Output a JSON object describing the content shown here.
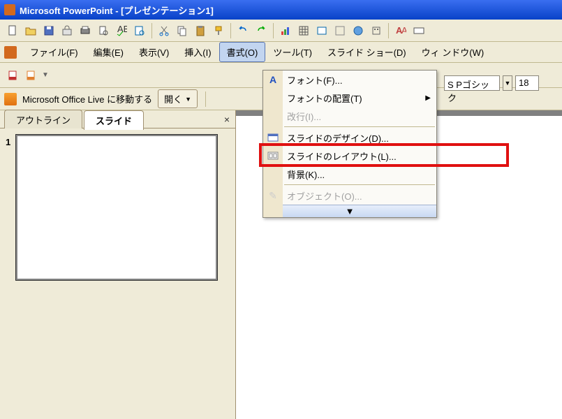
{
  "title": "Microsoft PowerPoint - [プレゼンテーション1]",
  "menubar": {
    "file": "ファイル(F)",
    "edit": "編集(E)",
    "view": "表示(V)",
    "insert": "挿入(I)",
    "format": "書式(O)",
    "tools": "ツール(T)",
    "slideshow": "スライド ショー(D)",
    "window": "ウィ ンドウ(W)"
  },
  "officelive": {
    "label": "Microsoft Office Live に移動する",
    "open": "開く"
  },
  "tabs": {
    "outline": "アウトライン",
    "slide": "スライド"
  },
  "slide_number": "1",
  "dropdown": {
    "font": "フォント(F)...",
    "font_align": "フォントの配置(T)",
    "line_break": "改行(I)...",
    "slide_design": "スライドのデザイン(D)...",
    "slide_layout": "スライドのレイアウト(L)...",
    "background": "背景(K)...",
    "object": "オブジェクト(O)...",
    "expand": "▼"
  },
  "font": {
    "name": "S Pゴシック",
    "size": "18"
  }
}
